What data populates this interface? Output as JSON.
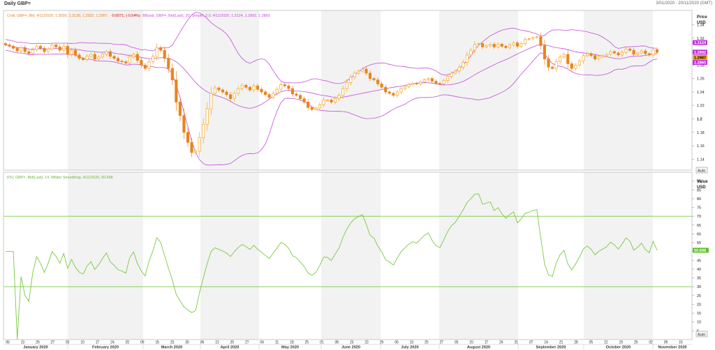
{
  "window": {
    "title": "Daily GBP=",
    "date_range": "3/01/2020 - 20/11/2020 (GMT)"
  },
  "legend": {
    "candle": "Cndl, GBP=, Bid, 4/11/2020, 1.3039, 1.3139, 1.2932, 1.2987,",
    "candle_change": "-0.0071, (-0.54%)",
    "bband": "BBand, GBP=, Bid(Last), 20, Simple, 2.0, 4/11/2020, 1.3124, 1.2992, 1.2860",
    "rsi": "RSI, GBP=, Bid(Last), 14, Wilder Smoothing, 4/11/2020, 50.698"
  },
  "price_axis": {
    "header_line1": "Price",
    "header_line2": "USD",
    "ticks": [
      "1.34",
      "1.32",
      "1.3",
      "1.28",
      "1.26",
      "1.24",
      "1.22",
      "1.2",
      "1.18",
      "1.16",
      "1.14"
    ],
    "bold_tick": "1.2",
    "ylim": [
      1.13,
      1.355
    ],
    "tags": {
      "upper": "1.3124",
      "middle": "1.2992",
      "close": "1.2987",
      "lower": "1.2860"
    }
  },
  "rsi_axis": {
    "header_line1": "Value",
    "header_line2": "USD",
    "ticks": [
      "90",
      "85",
      "80",
      "75",
      "70",
      "65",
      "60",
      "55",
      "50",
      "45",
      "40",
      "35",
      "30",
      "25",
      "20",
      "15",
      "10",
      "5"
    ],
    "ylim": [
      0,
      95
    ],
    "levels": [
      70,
      30
    ],
    "tag": "50.698"
  },
  "auto_buttons": [
    "Auto",
    "Auto"
  ],
  "x_axis": {
    "day_ticks": [
      "06",
      "13",
      "20",
      "27",
      "03",
      "10",
      "17",
      "24",
      "02",
      "09",
      "16",
      "23",
      "30",
      "06",
      "13",
      "20",
      "27",
      "04",
      "11",
      "18",
      "25",
      "01",
      "08",
      "15",
      "22",
      "29",
      "06",
      "13",
      "20",
      "27",
      "03",
      "10",
      "17",
      "24",
      "31",
      "07",
      "14",
      "21",
      "28",
      "05",
      "12",
      "19",
      "26",
      "02",
      "09",
      "16"
    ],
    "months": [
      "January 2020",
      "February 2020",
      "March 2020",
      "April 2020",
      "May 2020",
      "June 2020",
      "July 2020",
      "August 2020",
      "September 2020",
      "October 2020",
      "November 2020"
    ]
  },
  "colors": {
    "up": "#f5a623",
    "down": "#e8841a",
    "bband": "#c24fd8",
    "rsi": "#7ac943",
    "band_shade": "#f2f2f2",
    "tag_magenta": "#c030e0",
    "tag_orange": "#f0a020",
    "tag_green": "#5cc02a"
  },
  "chart_data": [
    {
      "type": "candlestick",
      "title": "Daily GBP=",
      "x_start": "2020-01-03",
      "x_end": "2020-11-04",
      "ylabel": "Price USD",
      "ylim": [
        1.13,
        1.355
      ],
      "close_series": [
        1.31,
        1.308,
        1.305,
        1.301,
        1.306,
        1.3,
        1.297,
        1.303,
        1.308,
        1.305,
        1.3,
        1.304,
        1.31,
        1.307,
        1.302,
        1.308,
        1.296,
        1.302,
        1.295,
        1.29,
        1.288,
        1.293,
        1.296,
        1.289,
        1.292,
        1.296,
        1.3,
        1.293,
        1.29,
        1.286,
        1.285,
        1.283,
        1.292,
        1.296,
        1.287,
        1.28,
        1.275,
        1.285,
        1.293,
        1.306,
        1.302,
        1.29,
        1.275,
        1.258,
        1.225,
        1.205,
        1.18,
        1.165,
        1.15,
        1.152,
        1.172,
        1.192,
        1.215,
        1.238,
        1.246,
        1.243,
        1.24,
        1.236,
        1.23,
        1.238,
        1.245,
        1.25,
        1.247,
        1.243,
        1.249,
        1.244,
        1.24,
        1.236,
        1.232,
        1.238,
        1.244,
        1.251,
        1.249,
        1.245,
        1.237,
        1.235,
        1.23,
        1.225,
        1.217,
        1.214,
        1.216,
        1.221,
        1.228,
        1.228,
        1.225,
        1.23,
        1.235,
        1.245,
        1.254,
        1.262,
        1.268,
        1.271,
        1.274,
        1.268,
        1.26,
        1.258,
        1.252,
        1.247,
        1.24,
        1.238,
        1.235,
        1.24,
        1.245,
        1.248,
        1.251,
        1.253,
        1.252,
        1.255,
        1.258,
        1.26,
        1.256,
        1.253,
        1.252,
        1.257,
        1.263,
        1.268,
        1.271,
        1.277,
        1.284,
        1.295,
        1.302,
        1.311,
        1.312,
        1.307,
        1.309,
        1.311,
        1.307,
        1.311,
        1.308,
        1.306,
        1.31,
        1.313,
        1.308,
        1.312,
        1.318,
        1.319,
        1.321,
        1.322,
        1.309,
        1.289,
        1.277,
        1.275,
        1.285,
        1.292,
        1.296,
        1.282,
        1.275,
        1.28,
        1.286,
        1.294,
        1.297,
        1.294,
        1.289,
        1.292,
        1.294,
        1.296,
        1.3,
        1.298,
        1.295,
        1.299,
        1.304,
        1.302,
        1.296,
        1.298,
        1.301,
        1.297,
        1.295,
        1.303,
        1.299
      ],
      "bband_period": 20,
      "bband_stddev": 2.0,
      "last_bar": {
        "date": "4/11/2020",
        "open": 1.3039,
        "high": 1.3139,
        "low": 1.2932,
        "close": 1.2987
      },
      "last_bband": {
        "upper": 1.3124,
        "middle": 1.2992,
        "lower": 1.286
      }
    },
    {
      "type": "line",
      "title": "RSI, GBP=, Bid(Last), 14, Wilder Smoothing",
      "ylabel": "Value USD",
      "ylim": [
        0,
        95
      ],
      "reference_lines": [
        70,
        30
      ],
      "last_value": 50.698
    }
  ]
}
